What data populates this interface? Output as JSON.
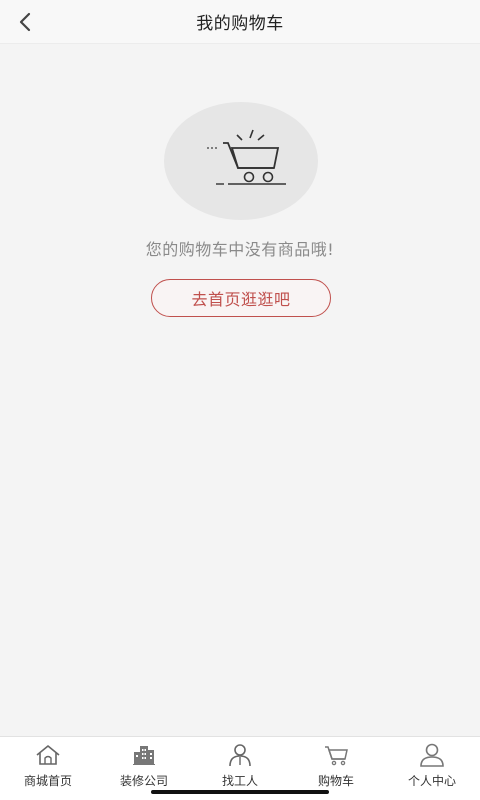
{
  "header": {
    "title": "我的购物车",
    "back_icon": "chevron-left-icon"
  },
  "empty_state": {
    "icon": "cart-icon",
    "message": "您的购物车中没有商品哦!",
    "button_label": "去首页逛逛吧",
    "accent_color": "#c0504d"
  },
  "tabbar": {
    "items": [
      {
        "label": "商城首页",
        "icon": "home-icon"
      },
      {
        "label": "装修公司",
        "icon": "building-icon"
      },
      {
        "label": "找工人",
        "icon": "worker-icon"
      },
      {
        "label": "购物车",
        "icon": "cart-icon"
      },
      {
        "label": "个人中心",
        "icon": "user-icon"
      }
    ]
  }
}
